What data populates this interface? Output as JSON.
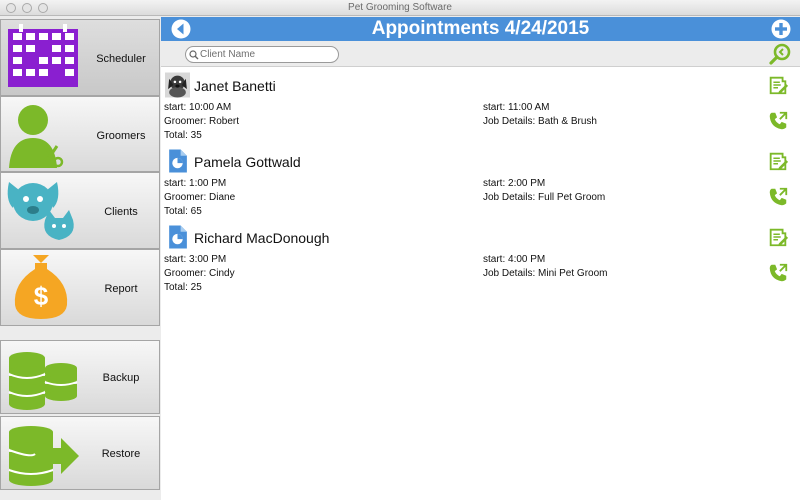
{
  "window": {
    "title": "Pet Grooming Software"
  },
  "sidebar": {
    "items": [
      {
        "label": "Scheduler",
        "icon": "calendar-icon",
        "active": true
      },
      {
        "label": "Groomers",
        "icon": "groomer-scissors-icon"
      },
      {
        "label": "Clients",
        "icon": "dog-cat-icon"
      },
      {
        "label": "Report",
        "icon": "money-bag-icon"
      },
      {
        "label": "Backup",
        "icon": "database-icon"
      },
      {
        "label": "Restore",
        "icon": "database-restore-icon"
      }
    ]
  },
  "header": {
    "title": "Appointments 4/24/2015",
    "back_icon": "back-arrow-icon",
    "add_icon": "add-icon"
  },
  "search": {
    "placeholder": "Client Name",
    "value": "",
    "search_icon": "magnifier-icon",
    "action_icon": "zoom-search-icon"
  },
  "appointments": [
    {
      "client": "Janet Banetti",
      "avatar": "dog-photo",
      "start": "start: 10:00 AM",
      "end": "start: 11:00 AM",
      "groomer": "Groomer: Robert",
      "job": "Job Details: Bath & Brush",
      "total": "Total: 35"
    },
    {
      "client": "Pamela Gottwald",
      "avatar": "document-chart-icon",
      "start": "start: 1:00 PM",
      "end": "start: 2:00 PM",
      "groomer": "Groomer: Diane",
      "job": "Job Details: Full Pet Groom",
      "total": "Total: 65"
    },
    {
      "client": "Richard MacDonough",
      "avatar": "document-chart-icon",
      "start": "start: 3:00 PM",
      "end": "start: 4:00 PM",
      "groomer": "Groomer: Cindy",
      "job": "Job Details: Mini Pet Groom",
      "total": "Total: 25"
    }
  ],
  "colors": {
    "accent": "#4a90d9",
    "green": "#7cb929",
    "purple": "#8a1fd0",
    "orange": "#f5a623",
    "teal": "#49b3c4"
  }
}
